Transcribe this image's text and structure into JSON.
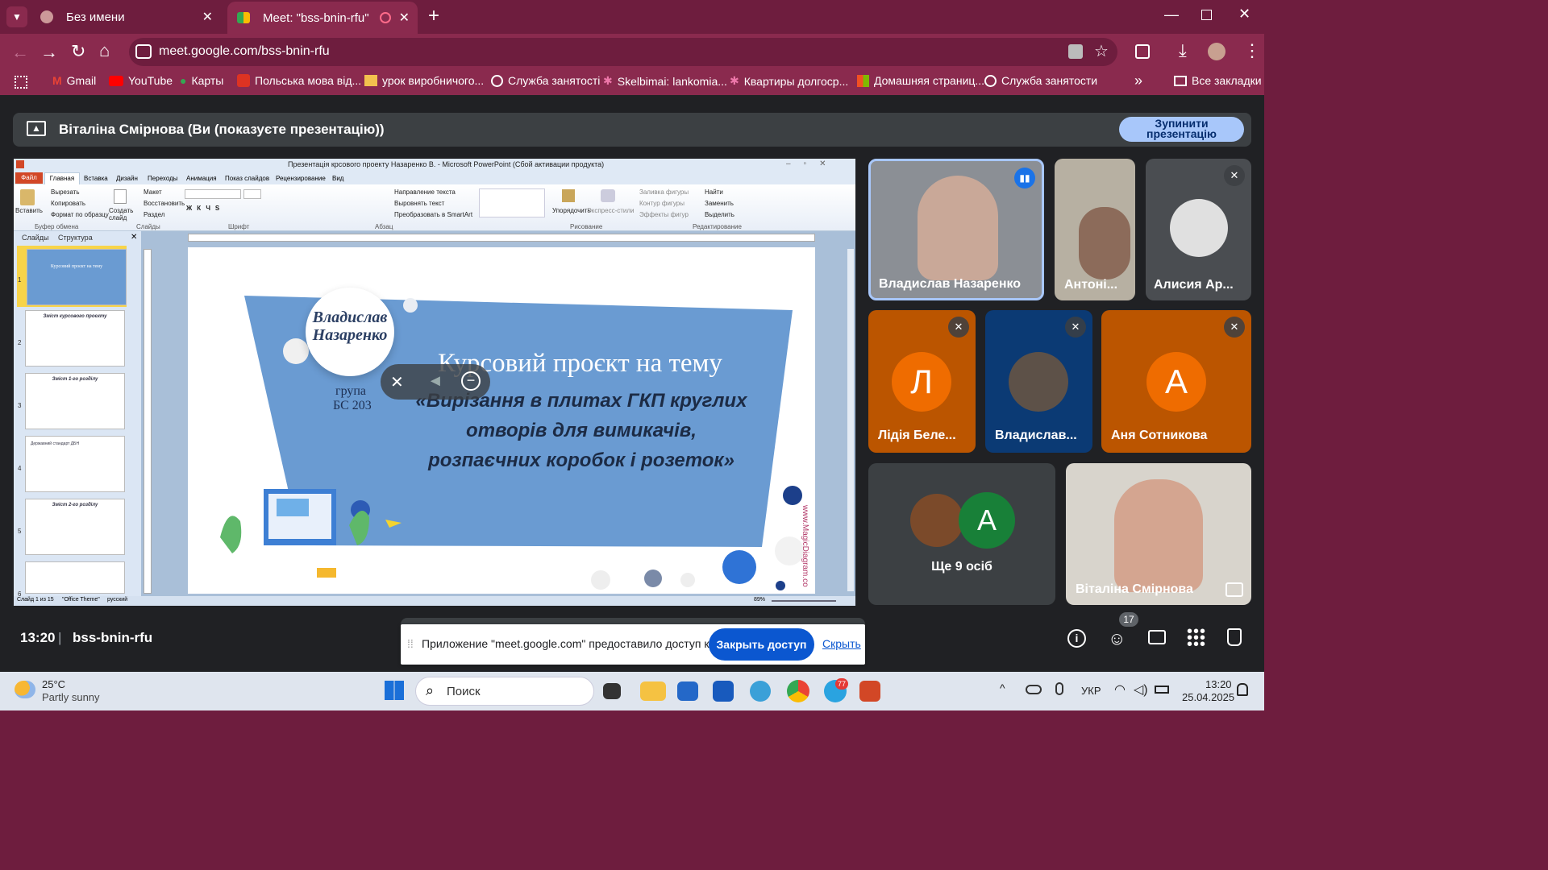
{
  "browser": {
    "tabs": [
      {
        "title": "Без имени"
      },
      {
        "title": "Meet: \"bss-bnin-rfu\""
      }
    ],
    "url": "meet.google.com/bss-bnin-rfu",
    "bookmarks": [
      "Gmail",
      "YouTube",
      "Карты",
      "Польська мова від...",
      "урок виробничого...",
      "Служба занятості",
      "Skelbimai: lankomia...",
      "Квартиры долгоср...",
      "Домашняя страниц...",
      "Служба занятости"
    ],
    "all_bookmarks": "Все закладки"
  },
  "meet": {
    "presenting_text": "Віталіна Смірнова (Ви (показуєте презентацію))",
    "stop_button": "Зупинити презентацію",
    "time": "13:20",
    "meeting_code": "bss-bnin-rfu",
    "participants_count": "17",
    "participants": [
      {
        "name": "Владислав Назаренко"
      },
      {
        "name": "Антоні..."
      },
      {
        "name": "Алисия Ар..."
      },
      {
        "name": "Лідія Беле...",
        "initial": "Л"
      },
      {
        "name": "Владислав..."
      },
      {
        "name": "Аня Сотникова",
        "initial": "А"
      },
      {
        "name": "Ще 9 осіб",
        "initial": "A"
      },
      {
        "name": "Віталіна Смірнова"
      }
    ],
    "share_toast": {
      "text": "Приложение \"meet.google.com\" предоставило доступ к окну.",
      "close_button": "Закрыть доступ",
      "hide_link": "Скрыть"
    }
  },
  "powerpoint": {
    "title": "Презентація крсового проекту Назаренко В. - Microsoft PowerPoint (Сбой активации продукта)",
    "tabs": [
      "Файл",
      "Главная",
      "Вставка",
      "Дизайн",
      "Переходы",
      "Анимация",
      "Показ слайдов",
      "Рецензирование",
      "Вид"
    ],
    "ribbon": {
      "paste": "Вставить",
      "cut": "Вырезать",
      "copy": "Копировать",
      "format_painter": "Формат по образцу",
      "clipboard": "Буфер обмена",
      "new_slide": "Создать слайд",
      "layout": "Макет",
      "reset": "Восстановить",
      "section": "Раздел",
      "slides": "Слайды",
      "font": "Шрифт",
      "text_direction": "Направление текста",
      "align_text": "Выровнять текст",
      "smartart": "Преобразовать в SmartArt",
      "paragraph": "Абзац",
      "arrange": "Упорядочить",
      "quick_styles": "Экспресс-стили",
      "shape_fill": "Заливка фигуры",
      "shape_outline": "Контур фигуры",
      "shape_effects": "Эффекты фигур",
      "drawing": "Рисование",
      "find": "Найти",
      "replace": "Заменить",
      "select": "Выделить",
      "editing": "Редактирование"
    },
    "panel_tabs": [
      "Слайды",
      "Структура"
    ],
    "thumb_labels": [
      "Курсовий проєкт на тему",
      "Зміст курсового проєкту",
      "Зміст 1-го розділу",
      "Державний стандарт ДБН",
      "Зміст 2-го розділу",
      ""
    ],
    "slide": {
      "author": "Владислав Назаренко",
      "group_label": "група",
      "group": "БС 203",
      "heading": "Курсовий проєкт на тему",
      "topic": "«Вирізання в плитах ГКП круглих отворів для вимикачів, розпаєчних коробок і розеток»",
      "watermark": "www.MagicDiagram.co"
    },
    "status": {
      "slide": "Слайд 1 из 15",
      "theme": "\"Office Theme\"",
      "lang": "русский",
      "zoom": "89%"
    }
  },
  "taskbar": {
    "weather_temp": "25°C",
    "weather_desc": "Partly sunny",
    "search": "Поиск",
    "lang": "УКР",
    "time": "13:20",
    "date": "25.04.2025",
    "telegram_badge": "77"
  },
  "colors": {
    "chrome_dark": "#6e1d3e",
    "chrome_light": "#8a2a4e",
    "meet_bg": "#202124",
    "accent_blue": "#0b57d0",
    "slide_blue": "#6a9bd2",
    "orange_avatar": "#ef6c00"
  }
}
